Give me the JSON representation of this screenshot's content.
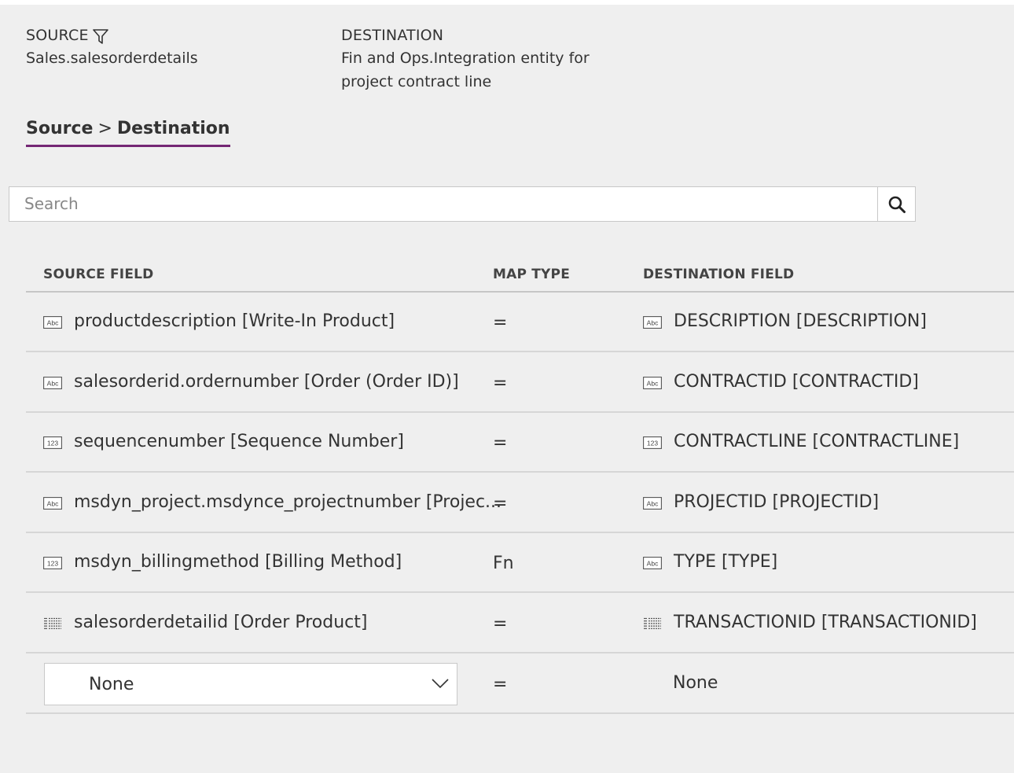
{
  "header": {
    "source_label": "SOURCE",
    "source_value": "Sales.salesorderdetails",
    "destination_label": "DESTINATION",
    "destination_value_line1": "Fin and Ops.Integration entity for",
    "destination_value_line2": "project contract line",
    "filter_icon": "filter-icon"
  },
  "breadcrumb": {
    "source": "Source",
    "separator": ">",
    "destination": "Destination",
    "underline_color": "#742774"
  },
  "search": {
    "placeholder": "Search",
    "icon": "search-icon"
  },
  "table": {
    "columns": [
      "SOURCE FIELD",
      "MAP TYPE",
      "DESTINATION FIELD"
    ],
    "rows": [
      {
        "source_icon": "text-field-icon",
        "source": "productdescription [Write-In Product]",
        "map_type": "=",
        "dest_icon": "text-field-icon",
        "destination": "DESCRIPTION [DESCRIPTION]"
      },
      {
        "source_icon": "text-field-icon",
        "source": "salesorderid.ordernumber [Order (Order ID)]",
        "map_type": "=",
        "dest_icon": "text-field-icon",
        "destination": "CONTRACTID [CONTRACTID]"
      },
      {
        "source_icon": "number-field-icon",
        "source": "sequencenumber [Sequence Number]",
        "map_type": "=",
        "dest_icon": "number-field-icon",
        "destination": "CONTRACTLINE [CONTRACTLINE]"
      },
      {
        "source_icon": "text-field-icon",
        "source": "msdyn_project.msdynce_projectnumber [Projec...",
        "map_type": "=",
        "dest_icon": "text-field-icon",
        "destination": "PROJECTID [PROJECTID]"
      },
      {
        "source_icon": "number-field-icon",
        "source": "msdyn_billingmethod [Billing Method]",
        "map_type": "Fn",
        "dest_icon": "text-field-icon",
        "destination": "TYPE [TYPE]"
      },
      {
        "source_icon": "list-field-icon",
        "source": "salesorderdetailid [Order Product]",
        "map_type": "=",
        "dest_icon": "list-field-icon",
        "destination": "TRANSACTIONID [TRANSACTIONID]"
      }
    ],
    "new_row": {
      "source_select": "None",
      "map_type": "=",
      "destination": "None"
    }
  },
  "icon_text": {
    "abc": "Abc",
    "num": "123"
  }
}
